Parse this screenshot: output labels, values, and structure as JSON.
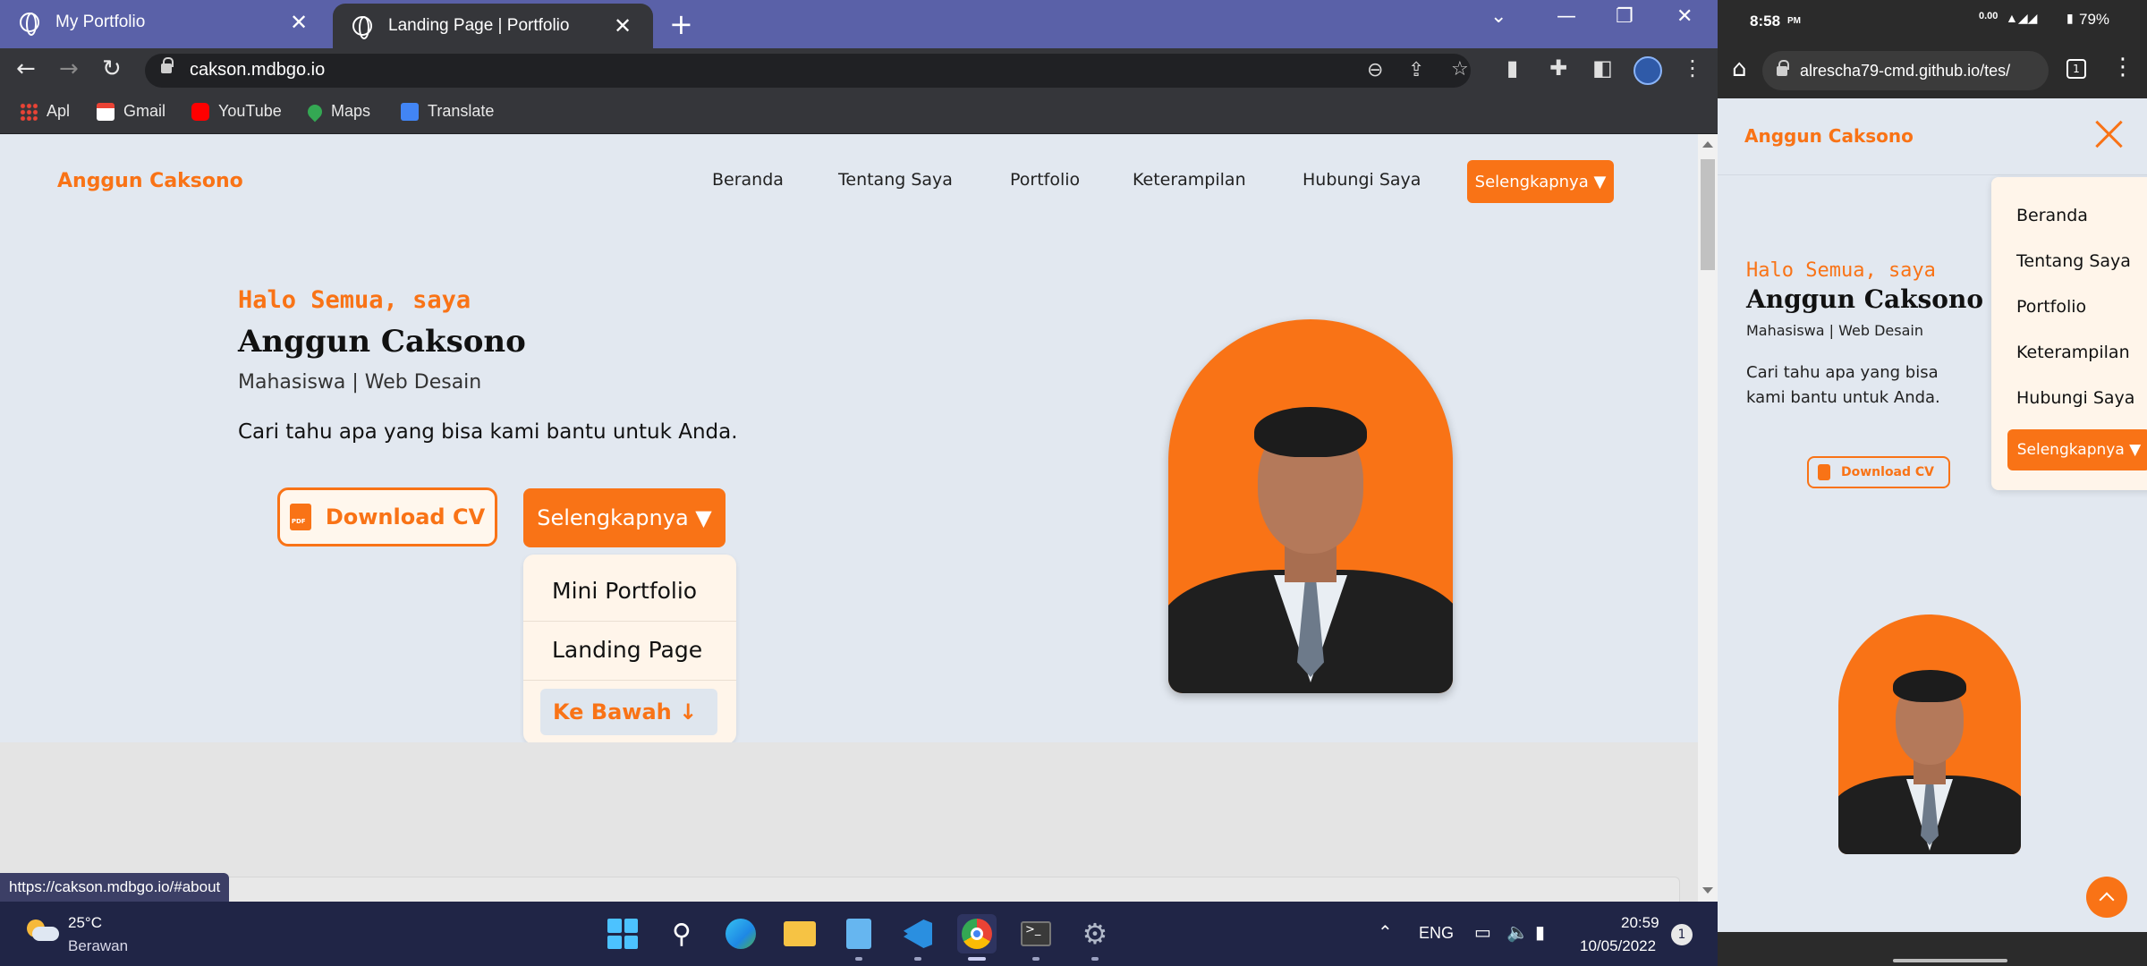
{
  "browser": {
    "tabs": [
      {
        "title": "My Portfolio",
        "close": "✕"
      },
      {
        "title": "Landing Page | Portfolio",
        "close": "✕"
      }
    ],
    "new_tab": "+",
    "url": "cakson.mdbgo.io",
    "bookmarks": [
      "Apl",
      "Gmail",
      "YouTube",
      "Maps",
      "Translate"
    ],
    "status_url": "https://cakson.mdbgo.io/#about"
  },
  "site": {
    "brand": "Anggun Caksono",
    "nav": [
      "Beranda",
      "Tentang Saya",
      "Portfolio",
      "Keterampilan",
      "Hubungi Saya"
    ],
    "nav_more": "Selengkapnya ▼",
    "greeting": "Halo Semua, saya",
    "name": "Anggun Caksono",
    "role": "Mahasiswa | Web Desain",
    "tagline": "Cari tahu apa yang bisa kami bantu untuk Anda.",
    "download_cv": "Download CV",
    "more_button": "Selengkapnya ▼",
    "dropdown": [
      "Mini Portfolio",
      "Landing Page",
      "Ke Bawah ↓"
    ]
  },
  "taskbar": {
    "temperature": "25°C",
    "weather": "Berawan",
    "language": "ENG",
    "time": "20:59",
    "date": "10/05/2022",
    "notifications": "1"
  },
  "phone": {
    "time": "8:58",
    "time_suffix": "PM",
    "net_speed": "0.00",
    "battery": "79%",
    "url": "alrescha79-cmd.github.io/tes/",
    "tab_count": "1",
    "brand": "Anggun Caksono",
    "greeting": "Halo Semua, saya",
    "name": "Anggun Caksono",
    "role": "Mahasiswa | Web Desain",
    "tagline": "Cari tahu apa yang bisa kami bantu untuk Anda.",
    "download_cv": "Download CV",
    "menu": [
      "Beranda",
      "Tentang Saya",
      "Portfolio",
      "Keterampilan",
      "Hubungi Saya"
    ],
    "menu_more": "Selengkapnya ▼"
  },
  "colors": {
    "accent": "#f97316",
    "page_bg": "#e2e8f0",
    "tab_bar": "#5a61a8"
  }
}
